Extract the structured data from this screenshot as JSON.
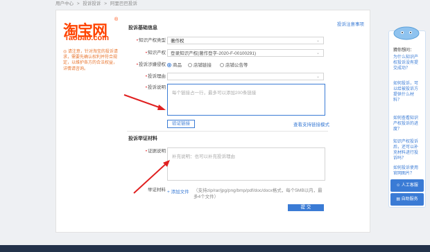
{
  "breadcrumb": [
    "用户中心",
    ">",
    "投诉投诉",
    ">",
    "阿里巴巴投诉"
  ],
  "logo": {
    "cn": "淘宝网",
    "en": "Taobao.com",
    "reg": "®"
  },
  "tip": "◎ 请注意，针对淘宝的投诉请求，需要先确认权利并符合规定，以维护各方的合法权益，详情请咨询。",
  "help_link": "投诉注意事项",
  "section1": "投诉基础信息",
  "rows": {
    "type_label": "知识产权类型",
    "type_value": "著作权",
    "ip_label": "知识产权",
    "ip_value": "登录知识产权(著作登字-2020-F-00100291)",
    "method_label": "投诉涉嫌侵权",
    "radio_options": [
      "商品",
      "店铺链接",
      "店铺公告等"
    ],
    "reason_label": "投诉理由",
    "desc_label": "投诉说明",
    "desc_placeholder": "每个链接占一行，最多可以添加200条链接"
  },
  "validate_button": "验证链接",
  "format_link": "查看支持链接模式",
  "section2": "投诉举证材料",
  "proof_label": "证据说明",
  "proof_placeholder": "补充说明：也可以补充投诉理由",
  "upload_label": "举证材料",
  "upload_link": "+ 添加文件",
  "upload_note": "（支持zip/rar/jpg/png/bmp/pdf/doc/docx格式，每个5MB以内，最多4个文件）",
  "submit_button": "提 交",
  "panel": {
    "title": "猜你想问：",
    "faqs": [
      "为什么知识产权投诉没有提交成功？",
      "如何投诉，可以给被投诉方提供什么材料？",
      "如何查看知识产权投诉的进度？",
      "知识产权投诉后，还可以补充材料进行投诉吗？",
      "如何投诉使用官网图片？"
    ],
    "btn1": "人工客服",
    "btn2": "自助服务"
  },
  "colors": {
    "brand": "#ff4400",
    "accent": "#3a7bd5",
    "required": "#e4393c",
    "arrow": "#e02020"
  }
}
